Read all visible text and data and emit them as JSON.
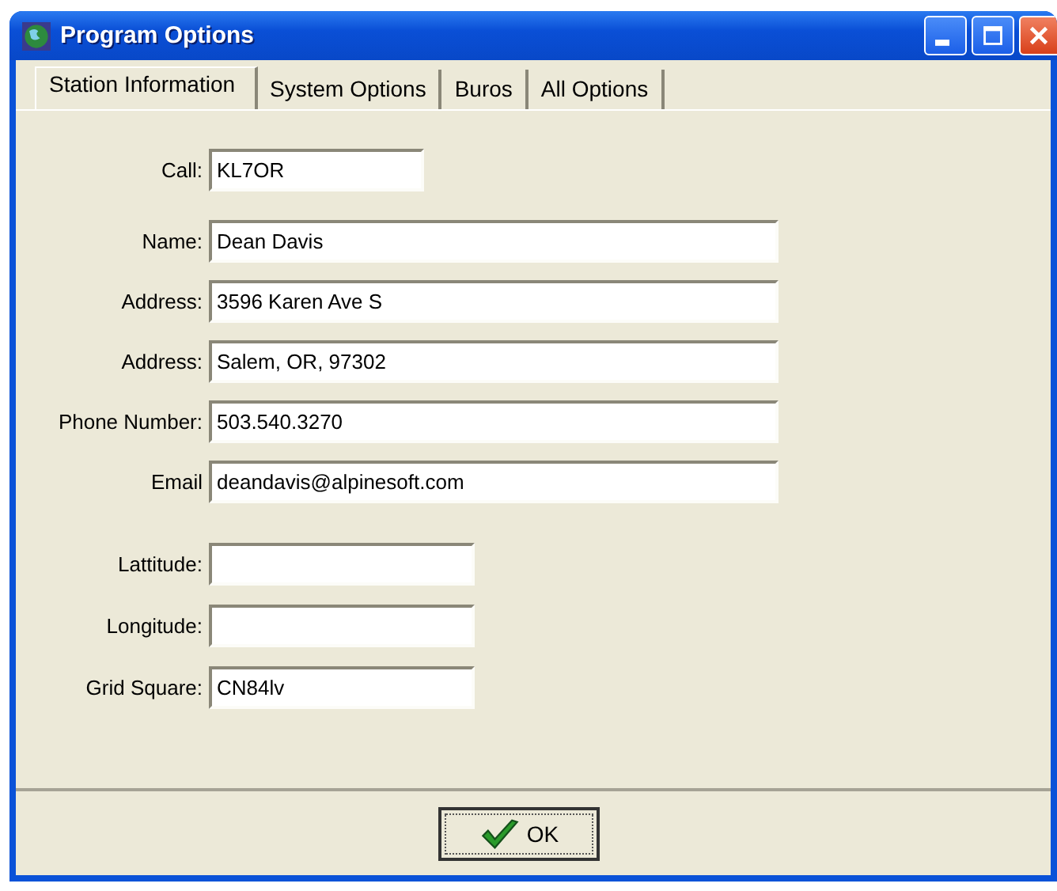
{
  "window": {
    "title": "Program Options"
  },
  "tabs": [
    {
      "label": "Station Information",
      "selected": true
    },
    {
      "label": "System Options",
      "selected": false
    },
    {
      "label": "Buros",
      "selected": false
    },
    {
      "label": "All Options",
      "selected": false
    }
  ],
  "contact_fields": [
    {
      "label": "Call:",
      "value": "KL7OR",
      "kind": "short"
    },
    {
      "label": "Name:",
      "value": "Dean Davis",
      "kind": "long"
    },
    {
      "label": "Address:",
      "value": "3596 Karen Ave S",
      "kind": "long"
    },
    {
      "label": "Address:",
      "value": "Salem, OR, 97302",
      "kind": "long"
    },
    {
      "label": "Phone Number:",
      "value": "503.540.3270",
      "kind": "long"
    },
    {
      "label": "Email",
      "value": "deandavis@alpinesoft.com",
      "kind": "long"
    }
  ],
  "location_fields": [
    {
      "label": "Lattitude:",
      "kind": "medium"
    },
    {
      "label": "Longitude:",
      "kind": "medium"
    },
    {
      "label": "Grid Square:",
      "value": "CN84lv",
      "kind": "medium"
    }
  ],
  "buttons": [
    {
      "label": "OK"
    }
  ]
}
